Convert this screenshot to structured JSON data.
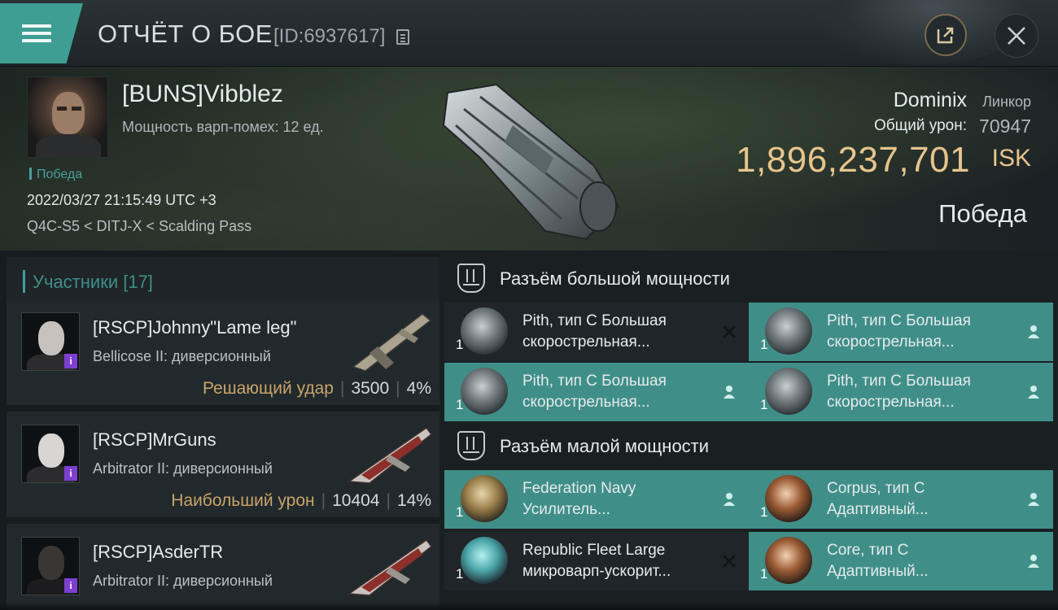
{
  "header": {
    "title": "ОТЧЁТ О БОЕ",
    "report_id": "[ID:6937617]"
  },
  "victim": {
    "name": "[BUNS]Vibblez",
    "warp_disruption": "Мощность варп-помех: 12 ед.",
    "result_badge": "Победа",
    "datetime": "2022/03/27 21:15:49 UTC +3",
    "location": "Q4C-S5 < DITJ-X < Scalding Pass",
    "ship_name": "Dominix",
    "ship_class": "Линкор",
    "damage_label": "Общий урон:",
    "damage_value": "70947",
    "isk_value": "1,896,237,701",
    "isk_unit": "ISK",
    "outcome": "Победа"
  },
  "participants": {
    "header": "Участники [17]",
    "items": [
      {
        "name": "[RSCP]Johnny\"Lame leg\"",
        "ship": "Bellicose II: диверсионный",
        "role": "Решающий удар",
        "damage": "3500",
        "percent": "4%"
      },
      {
        "name": "[RSCP]MrGuns",
        "ship": "Arbitrator II: диверсионный",
        "role": "Наибольший урон",
        "damage": "10404",
        "percent": "14%"
      },
      {
        "name": "[RSCP]AsderTR",
        "ship": "Arbitrator II: диверсионный",
        "role": "",
        "damage": "",
        "percent": ""
      }
    ]
  },
  "fitting": {
    "high_slots": {
      "title": "Разъём большой мощности",
      "modules": [
        {
          "name": "Pith, тип C Большая скорострельная...",
          "qty": "1",
          "status": "destroyed"
        },
        {
          "name": "Pith, тип C Большая скорострельная...",
          "qty": "1",
          "status": "dropped"
        },
        {
          "name": "Pith, тип C Большая скорострельная...",
          "qty": "1",
          "status": "dropped"
        },
        {
          "name": "Pith, тип C Большая скорострельная...",
          "qty": "1",
          "status": "dropped"
        }
      ]
    },
    "low_slots": {
      "title": "Разъём малой мощности",
      "modules": [
        {
          "name": "Federation Navy Усилитель...",
          "qty": "1",
          "status": "dropped"
        },
        {
          "name": "Corpus, тип C Адаптивный...",
          "qty": "1",
          "status": "dropped"
        },
        {
          "name": "Republic Fleet Large микроварп-ускорит...",
          "qty": "1",
          "status": "destroyed"
        },
        {
          "name": "Core, тип C Адаптивный...",
          "qty": "1",
          "status": "dropped"
        }
      ]
    }
  },
  "colors": {
    "accent": "#3f9e93",
    "isk": "#e7c48d",
    "role": "#c8a46a",
    "badge": "#7d3fcf"
  }
}
